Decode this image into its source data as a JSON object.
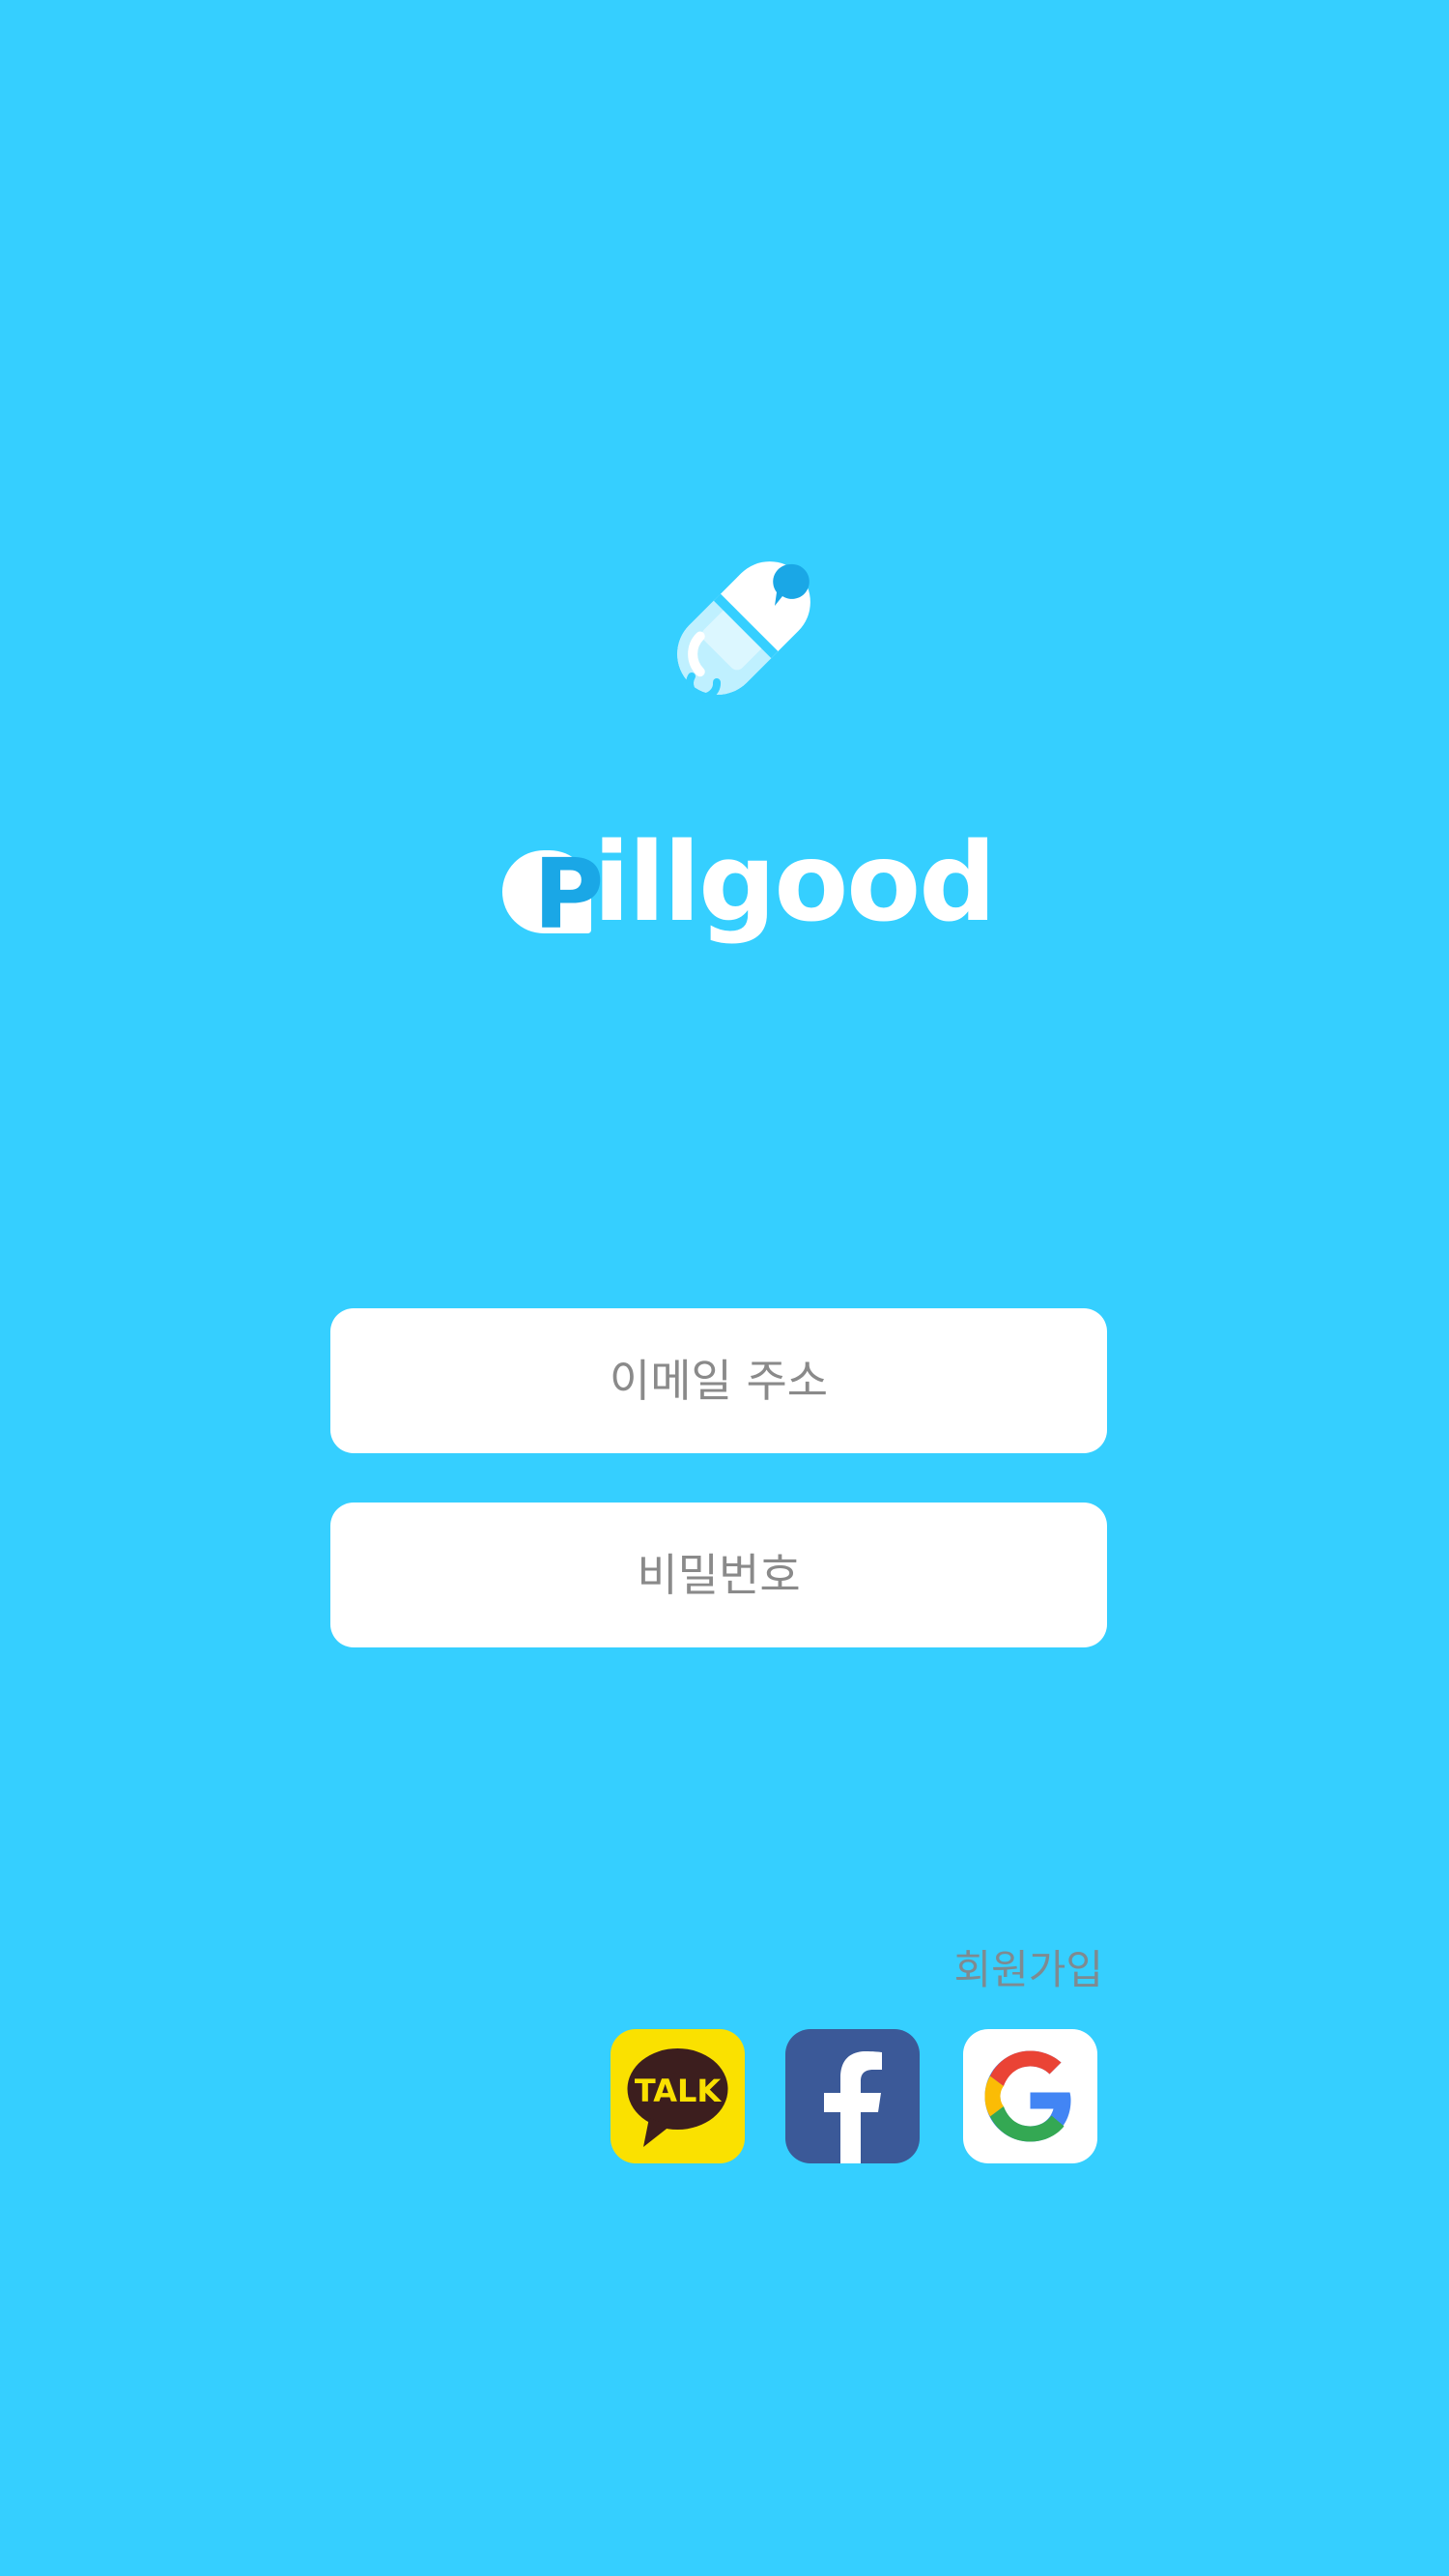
{
  "app": {
    "brand_first_letter": "P",
    "brand_rest": "illgood"
  },
  "login": {
    "email_placeholder": "이메일 주소",
    "password_placeholder": "비밀번호"
  },
  "signup": {
    "label": "회원가입"
  },
  "social": {
    "kakao_label": "TALK",
    "facebook_icon": "facebook-icon",
    "google_icon": "google-icon"
  },
  "colors": {
    "background": "#35cfff",
    "kakao": "#fae100",
    "facebook": "#3b5998",
    "logo_accent": "#1aa7e6"
  }
}
